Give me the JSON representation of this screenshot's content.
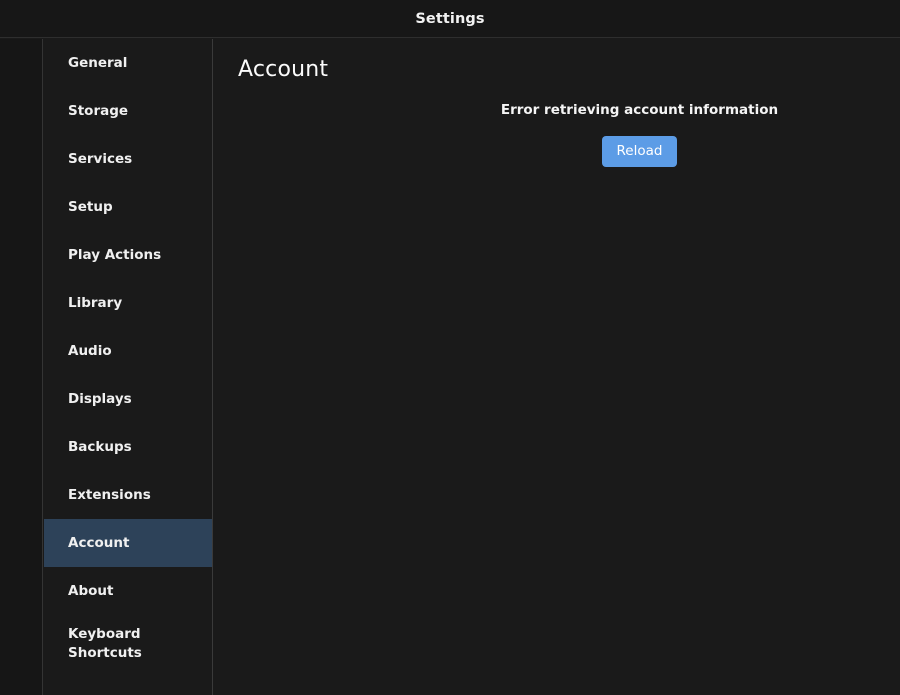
{
  "window": {
    "title": "Settings"
  },
  "sidebar": {
    "items": [
      {
        "label": "General",
        "selected": false,
        "two_line": false
      },
      {
        "label": "Storage",
        "selected": false,
        "two_line": false
      },
      {
        "label": "Services",
        "selected": false,
        "two_line": false
      },
      {
        "label": "Setup",
        "selected": false,
        "two_line": false
      },
      {
        "label": "Play Actions",
        "selected": false,
        "two_line": false
      },
      {
        "label": "Library",
        "selected": false,
        "two_line": false
      },
      {
        "label": "Audio",
        "selected": false,
        "two_line": false
      },
      {
        "label": "Displays",
        "selected": false,
        "two_line": false
      },
      {
        "label": "Backups",
        "selected": false,
        "two_line": false
      },
      {
        "label": "Extensions",
        "selected": false,
        "two_line": false
      },
      {
        "label": "Account",
        "selected": true,
        "two_line": false
      },
      {
        "label": "About",
        "selected": false,
        "two_line": false
      },
      {
        "label": "Keyboard Shortcuts",
        "selected": false,
        "two_line": true
      }
    ]
  },
  "main": {
    "page_title": "Account",
    "error_message": "Error retrieving account information",
    "reload_label": "Reload"
  },
  "colors": {
    "app_background": "#1a1a1a",
    "titlebar_background": "#171717",
    "sidebar_selected": "#2d4259",
    "accent_button": "#5c9ce6",
    "text_primary": "#f5f5f5"
  }
}
